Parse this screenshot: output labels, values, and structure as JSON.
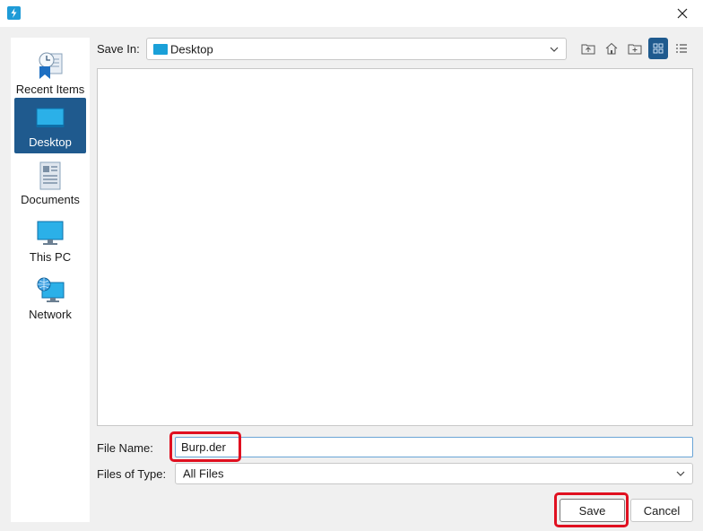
{
  "window": {
    "close_icon": "close-icon",
    "app_icon": "app-icon"
  },
  "places": [
    {
      "label": "Recent Items",
      "icon": "recent-items-icon",
      "selected": false
    },
    {
      "label": "Desktop",
      "icon": "desktop-icon",
      "selected": true
    },
    {
      "label": "Documents",
      "icon": "documents-icon",
      "selected": false
    },
    {
      "label": "This PC",
      "icon": "this-pc-icon",
      "selected": false
    },
    {
      "label": "Network",
      "icon": "network-icon",
      "selected": false
    }
  ],
  "save_in": {
    "label": "Save In:",
    "value": "Desktop"
  },
  "toolbar": {
    "up_icon": "up-folder-icon",
    "home_icon": "home-icon",
    "new_folder_icon": "new-folder-icon",
    "list_view_icon": "list-view-icon",
    "details_view_icon": "details-view-icon"
  },
  "file_name": {
    "label": "File Name:",
    "value": "Burp.der"
  },
  "file_type": {
    "label": "Files of Type:",
    "value": "All Files"
  },
  "buttons": {
    "save": "Save",
    "cancel": "Cancel"
  },
  "colors": {
    "selection": "#1f5a8e",
    "highlight": "#e01020",
    "accent": "#1aa0d8"
  }
}
